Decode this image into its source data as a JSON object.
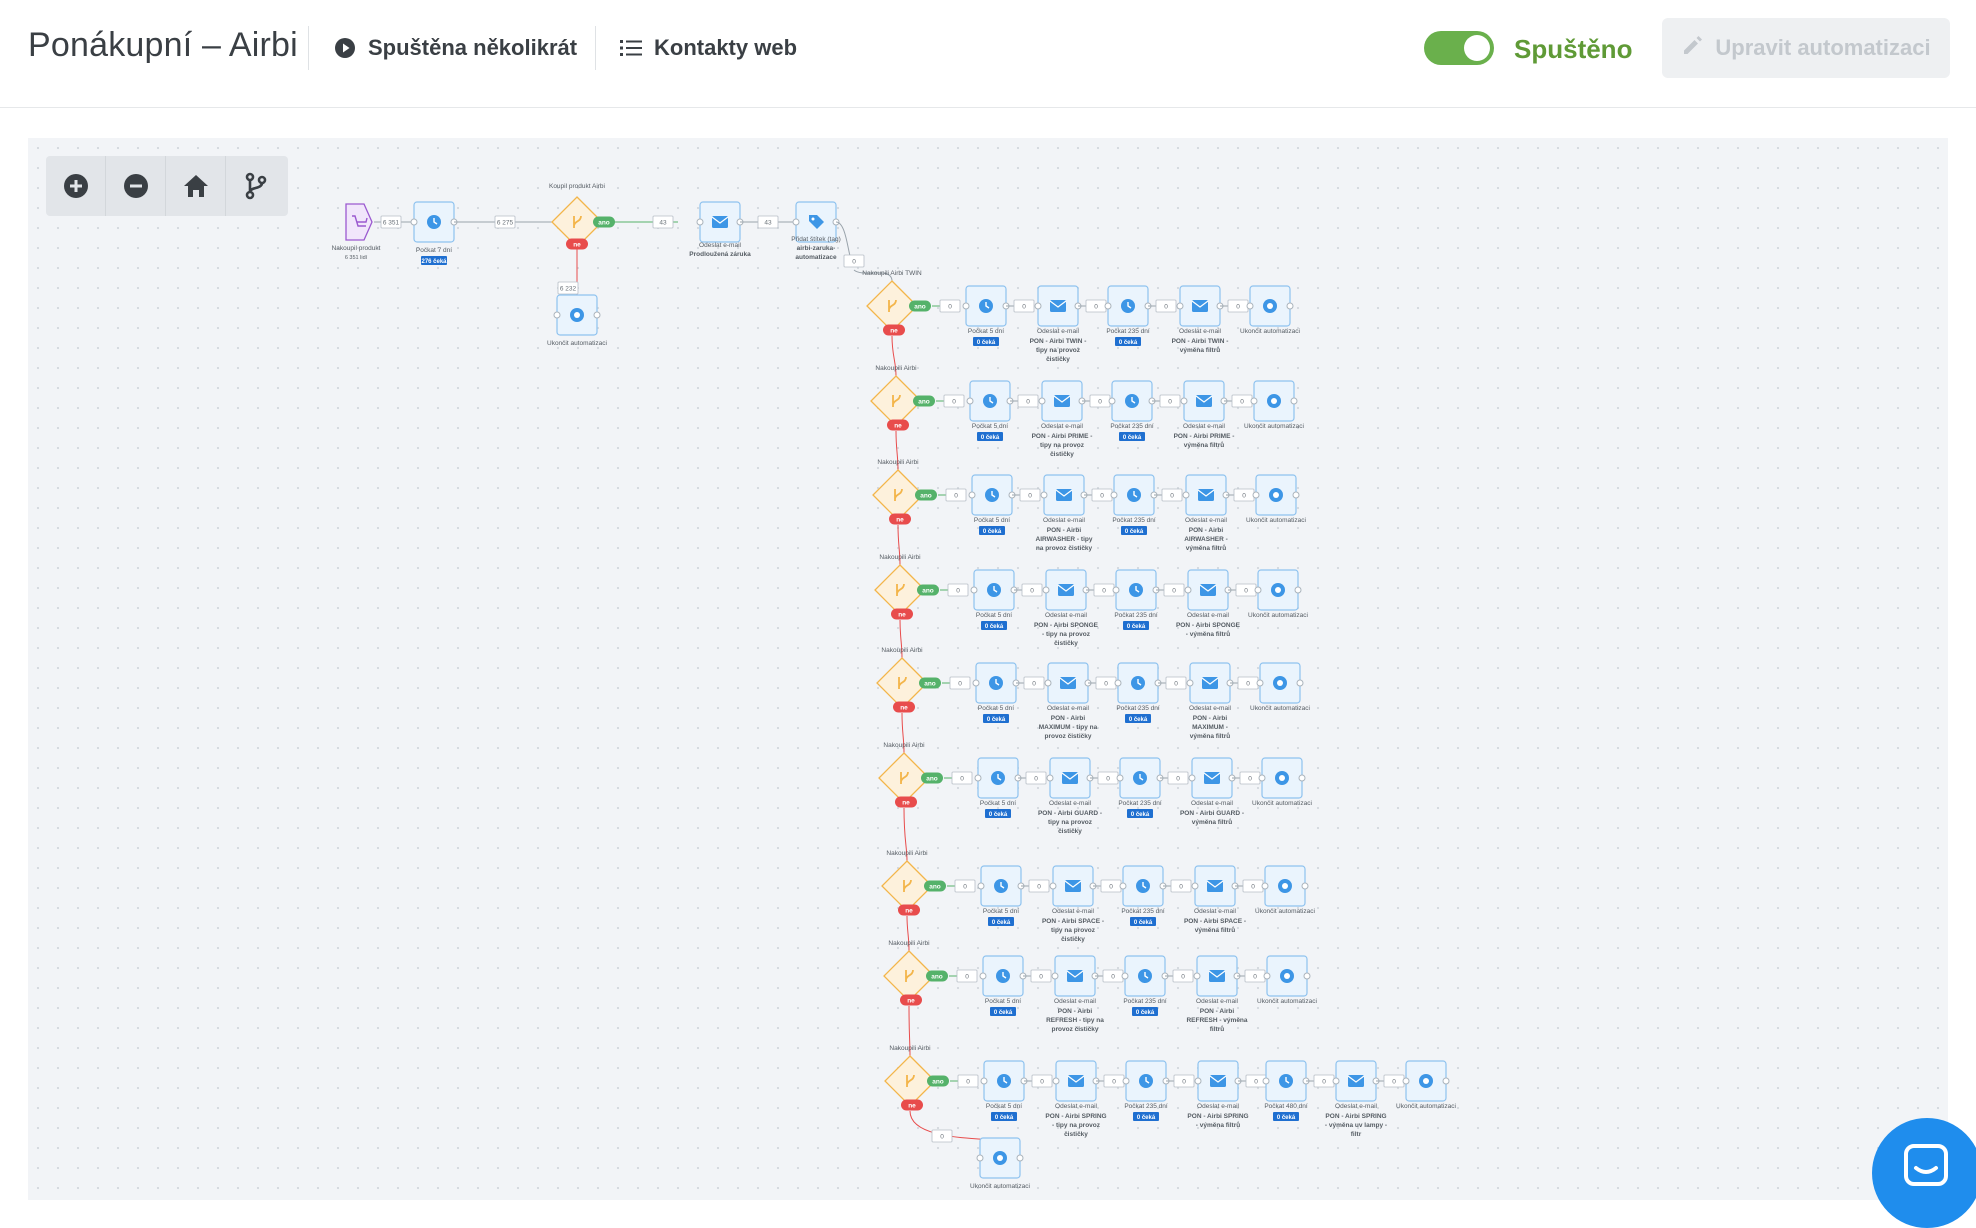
{
  "header": {
    "title": "Ponákupní – Airbi",
    "run_label": "Spuštěna několikrát",
    "contacts_label": "Kontakty web",
    "status_label": "Spuštěno",
    "edit_label": "Upravit automatizaci"
  },
  "toolbar": {
    "zoom_in": "zoom-in",
    "zoom_out": "zoom-out",
    "home": "home",
    "branch": "branch"
  },
  "colors": {
    "accent_green": "#6ab04c",
    "node_blue": "#3d96e6",
    "yes_green": "#55b26a",
    "no_red": "#e84c4c",
    "condition_orange": "#f3b54a",
    "trigger_purple": "#9b59d0"
  },
  "flow": {
    "trigger": {
      "label": "Nakoupil produkt",
      "count": "6 351 lidí"
    },
    "top_counts": {
      "c1": "6 351",
      "c2": "6 275",
      "c3": "43",
      "c4": "43",
      "c5": "0",
      "c_no": "6 232"
    },
    "wait7": {
      "label": "Počkat 7 dní",
      "badge": "276 čeká"
    },
    "cond_main": {
      "label": "Koupil produkt Airbi"
    },
    "email_main": {
      "line1": "Odeslat e-mail",
      "line2": "Prodloužená záruka"
    },
    "tag": {
      "line1": "Přidat štítek (tag)",
      "line2": "airbi-zaruka-",
      "line3": "automatizace"
    },
    "end_main": {
      "label": "Ukončit automatizaci"
    },
    "yes": "ano",
    "no": "ne",
    "zero": "0",
    "wait5": "Počkat 5 dní",
    "wait235": "Počkat 235 dní",
    "wait480": "Počkat 480 dní",
    "waiting_badge": "0 čeká",
    "send_email": "Odeslat e-mail",
    "end_label": "Ukončit automatizaci",
    "branches": [
      {
        "cond": "Nakoupili Airbi TWIN",
        "mail1": [
          "PON - Airbi TWIN -",
          "tipy na provoz",
          "čističky"
        ],
        "mail2": [
          "PON - Airbi TWIN -",
          "výměna filtrů"
        ]
      },
      {
        "cond": "Nakoupili Airbi",
        "mail1": [
          "PON - Airbi PRIME -",
          "tipy na provoz",
          "čističky"
        ],
        "mail2": [
          "PON - Airbi PRIME -",
          "výměna filtrů"
        ]
      },
      {
        "cond": "Nakoupili Airbi",
        "mail1": [
          "PON - Airbi",
          "AIRWASHER - tipy",
          "na provoz čističky"
        ],
        "mail2": [
          "PON - Airbi",
          "AIRWASHER -",
          "výměna filtrů"
        ]
      },
      {
        "cond": "Nakoupili Airbi",
        "mail1": [
          "PON - Airbi SPONGE",
          "- tipy na provoz",
          "čističky"
        ],
        "mail2": [
          "PON - Airbi SPONGE",
          "- výměna filtrů"
        ]
      },
      {
        "cond": "Nakoupili Airbi",
        "mail1": [
          "PON - Airbi",
          "MAXIMUM - tipy na",
          "provoz čističky"
        ],
        "mail2": [
          "PON - Airbi",
          "MAXIMUM -",
          "výměna filtrů"
        ]
      },
      {
        "cond": "Nakoupili Airbi",
        "mail1": [
          "PON - Airbi GUARD -",
          "tipy na provoz",
          "čističky"
        ],
        "mail2": [
          "PON - Airbi GUARD -",
          "výměna filtrů"
        ]
      },
      {
        "cond": "Nakoupili Airbi",
        "mail1": [
          "PON - Airbi SPACE -",
          "tipy na provoz",
          "čističky"
        ],
        "mail2": [
          "PON - Airbi SPACE -",
          "výměna filtrů"
        ]
      },
      {
        "cond": "Nakoupili Airbi",
        "mail1": [
          "PON - Airbi",
          "REFRESH - tipy na",
          "provoz čističky"
        ],
        "mail2": [
          "PON - Airbi",
          "REFRESH - výměna",
          "filtrů"
        ]
      },
      {
        "cond": "Nakoupili Airbi",
        "mail1": [
          "PON - Airbi SPRING",
          "- tipy na provoz",
          "čističky"
        ],
        "mail2": [
          "PON - Airbi SPRING",
          "- výměna filtrů"
        ],
        "mail3": [
          "PON - Airbi SPRING",
          "- výměna uv lampy -",
          "filtr"
        ]
      }
    ]
  },
  "chat": {
    "icon": "chat-icon"
  }
}
